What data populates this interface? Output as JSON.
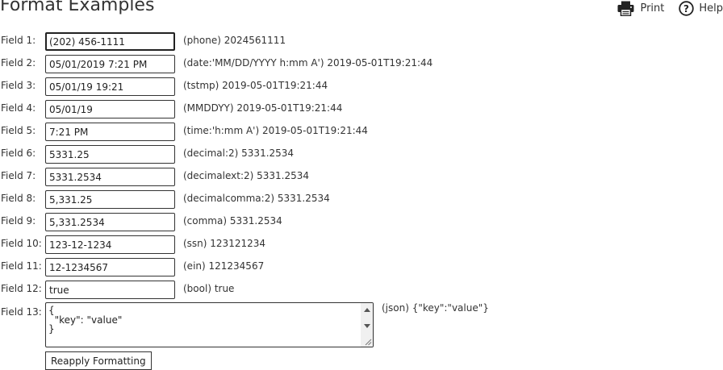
{
  "header": {
    "title": "Format Examples",
    "print_label": "Print",
    "help_label": "Help"
  },
  "fields": [
    {
      "label": "Field 1:",
      "value": "(202) 456-1111",
      "note": "(phone) 2024561111"
    },
    {
      "label": "Field 2:",
      "value": "05/01/2019 7:21 PM",
      "note": "(date:'MM/DD/YYYY h:mm A') 2019-05-01T19:21:44"
    },
    {
      "label": "Field 3:",
      "value": "05/01/19 19:21",
      "note": "(tstmp) 2019-05-01T19:21:44"
    },
    {
      "label": "Field 4:",
      "value": "05/01/19",
      "note": "(MMDDYY) 2019-05-01T19:21:44"
    },
    {
      "label": "Field 5:",
      "value": "7:21 PM",
      "note": "(time:'h:mm A') 2019-05-01T19:21:44"
    },
    {
      "label": "Field 6:",
      "value": "5331.25",
      "note": "(decimal:2) 5331.2534"
    },
    {
      "label": "Field 7:",
      "value": "5331.2534",
      "note": "(decimalext:2) 5331.2534"
    },
    {
      "label": "Field 8:",
      "value": "5,331.25",
      "note": "(decimalcomma:2) 5331.2534"
    },
    {
      "label": "Field 9:",
      "value": "5,331.2534",
      "note": "(comma) 5331.2534"
    },
    {
      "label": "Field 10:",
      "value": "123-12-1234",
      "note": "(ssn) 123121234"
    },
    {
      "label": "Field 11:",
      "value": "12-1234567",
      "note": "(ein) 121234567"
    },
    {
      "label": "Field 12:",
      "value": "true",
      "note": "(bool) true"
    }
  ],
  "json_field": {
    "label": "Field 13:",
    "value": "{\n  \"key\": \"value\"\n}",
    "note": "(json) {\"key\":\"value\"}"
  },
  "actions": {
    "reapply_label": "Reapply Formatting"
  },
  "icons": {
    "print": "printer-icon",
    "help": "question-circle-icon"
  }
}
